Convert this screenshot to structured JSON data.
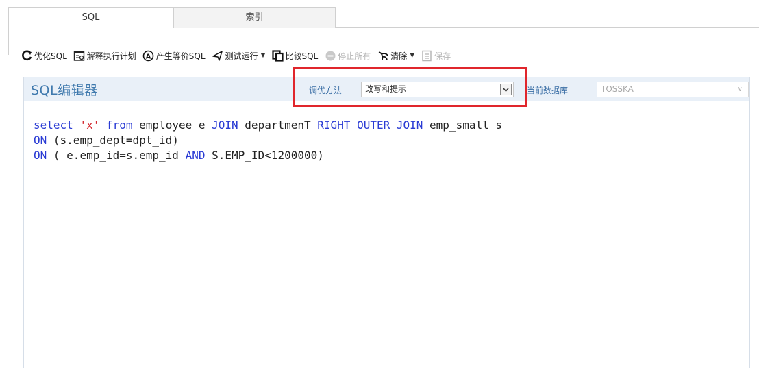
{
  "tabs": [
    {
      "label": "SQL",
      "active": true
    },
    {
      "label": "索引",
      "active": false
    }
  ],
  "toolbar": {
    "optimize_sql": "优化SQL",
    "explain_plan": "解释执行计划",
    "gen_equiv_sql": "产生等价SQL",
    "test_run": "测试运行",
    "compare_sql": "比较SQL",
    "stop_all": "停止所有",
    "clear": "清除",
    "save": "保存"
  },
  "editor": {
    "title": "SQL编辑器",
    "tuning_method_label": "调优方法",
    "tuning_method_value": "改写和提示",
    "current_db_label": "当前数据库",
    "current_db_value": "TOSSKA"
  },
  "code": {
    "l1_select": "select",
    "l1_str": "'x'",
    "l1_from": "from",
    "l1_t1": "employee e",
    "l1_join": "JOIN",
    "l1_t2": "departmenT",
    "l1_roj": "RIGHT OUTER JOIN",
    "l1_t3": "emp_small s",
    "l2_on": "ON",
    "l2_cond": "(s.emp_dept=dpt_id)",
    "l3_on": "ON",
    "l3_cond1": "( e.emp_id=s.emp_id",
    "l3_and": "AND",
    "l3_cond2": "S.EMP_ID<1200000)"
  },
  "colors": {
    "accent_blue": "#3f79ad",
    "keyword": "#2a3bd4",
    "string": "#d3282f",
    "highlight": "#e0262c",
    "header_bg": "#e9f0f8"
  },
  "icons": {
    "optimize": "refresh-arrow-icon",
    "explain": "plan-table-icon",
    "equiv": "circle-a-icon",
    "test": "run-flag-icon",
    "compare": "copy-compare-icon",
    "stop": "stop-circle-icon",
    "clear": "broom-icon",
    "save": "save-doc-icon"
  }
}
